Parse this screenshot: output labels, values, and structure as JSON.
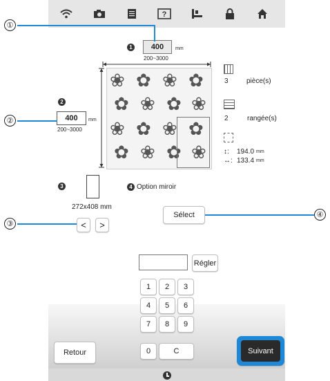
{
  "toolbar": {
    "icons": [
      "wifi-icon",
      "camera-icon",
      "document-icon",
      "help-icon",
      "embroidery-frame-icon",
      "lock-icon",
      "home-icon"
    ]
  },
  "width_setting": {
    "marker": "1",
    "value": "400",
    "unit": "mm",
    "range": "200~3000"
  },
  "height_setting": {
    "marker": "2",
    "value": "400",
    "unit": "mm",
    "range": "200~3000"
  },
  "pieces": {
    "count": "3",
    "label": "pièce(s)"
  },
  "rows": {
    "count": "2",
    "label": "rangée(s)"
  },
  "pattern_size": {
    "height": "194.0",
    "width": "133.4",
    "unit": "mm",
    "height_symbol": "↕:",
    "width_symbol": "↔:"
  },
  "frame": {
    "marker": "3",
    "size": "272x408 mm",
    "prev_label": "<",
    "next_label": ">"
  },
  "mirror": {
    "marker": "4",
    "label": "Option miroir",
    "button_label": "Sélect"
  },
  "keypad": {
    "input_value": "",
    "set_label": "Régler",
    "keys": [
      "1",
      "2",
      "3",
      "4",
      "5",
      "6",
      "7",
      "8",
      "9",
      "0",
      "C"
    ]
  },
  "footer": {
    "back_label": "Retour",
    "next_label": "Suivant"
  },
  "callouts": {
    "c1": "①",
    "c2": "②",
    "c3": "③",
    "c4": "④"
  },
  "colors": {
    "accent": "#1e88d6",
    "topbar": "#e6e6e6"
  }
}
